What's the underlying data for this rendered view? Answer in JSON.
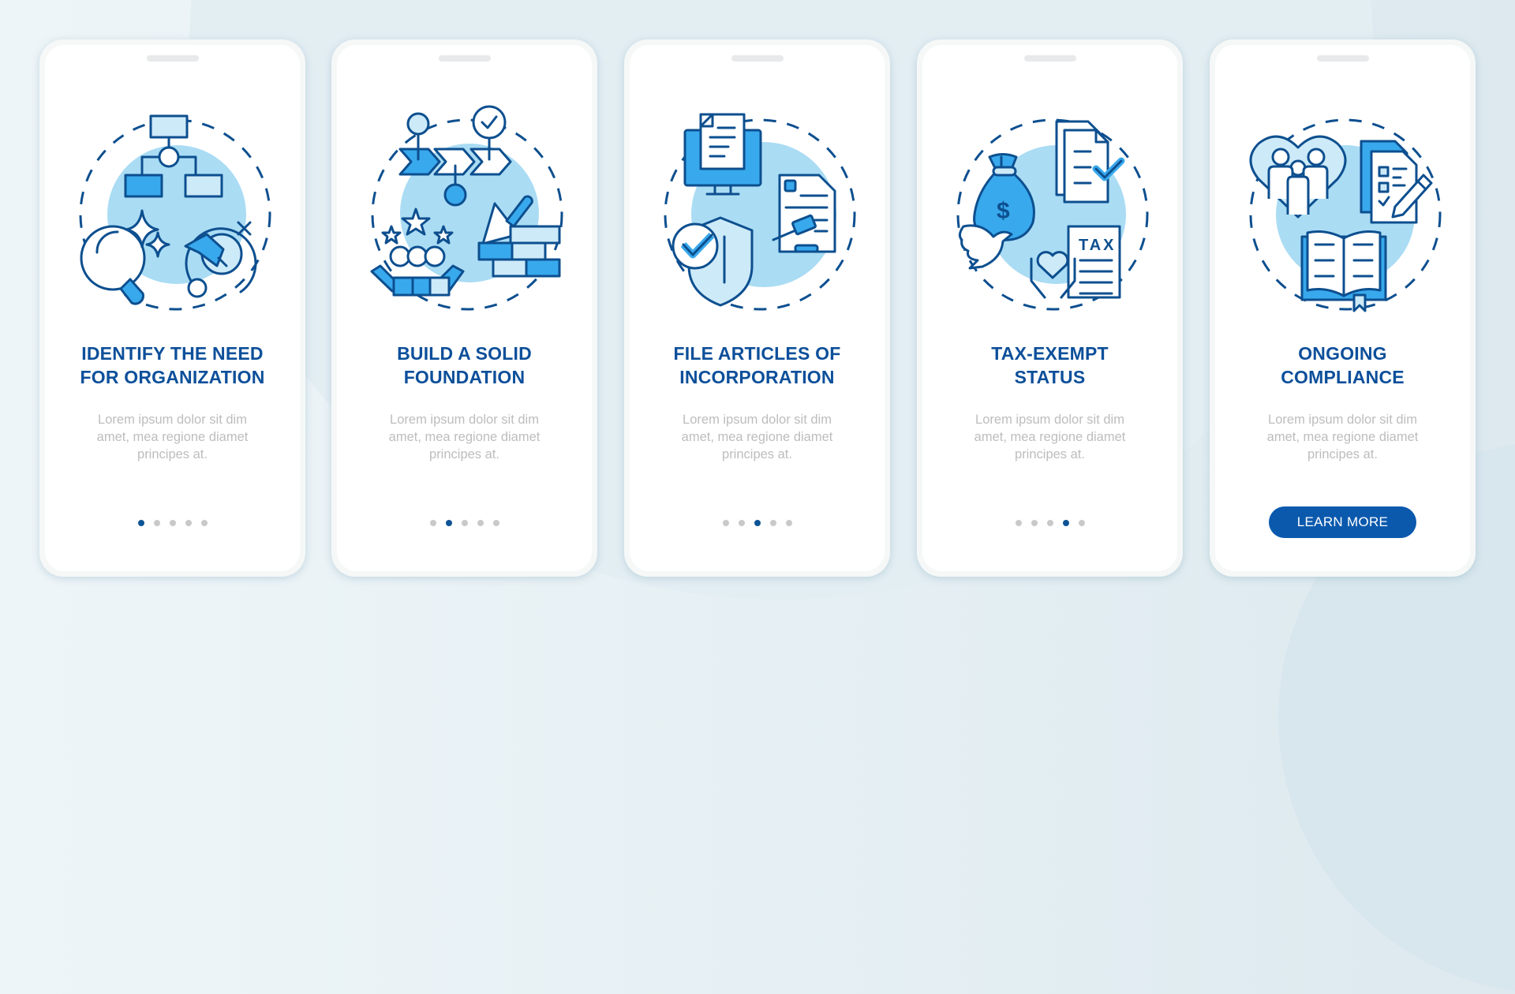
{
  "screens": [
    {
      "illustration": "organization-chart-icon",
      "title_lines": [
        "IDENTIFY THE NEED",
        "FOR ORGANIZATION"
      ],
      "description_lines": [
        "Lorem ipsum dolor sit dim",
        "amet, mea regione diamet",
        "principes at."
      ],
      "active_dot": 1
    },
    {
      "illustration": "foundation-bricks-icon",
      "title_lines": [
        "BUILD A SOLID",
        "FOUNDATION"
      ],
      "description_lines": [
        "Lorem ipsum dolor sit dim",
        "amet, mea regione diamet",
        "principes at."
      ],
      "active_dot": 2
    },
    {
      "illustration": "legal-documents-icon",
      "title_lines": [
        "FILE ARTICLES OF",
        "INCORPORATION"
      ],
      "description_lines": [
        "Lorem ipsum dolor sit dim",
        "amet, mea regione diamet",
        "principes at."
      ],
      "active_dot": 3
    },
    {
      "illustration": "tax-exempt-icon",
      "title_lines": [
        "TAX-EXEMPT",
        "STATUS"
      ],
      "description_lines": [
        "Lorem ipsum dolor sit dim",
        "amet, mea regione diamet",
        "principes at."
      ],
      "active_dot": 4
    },
    {
      "illustration": "compliance-book-icon",
      "title_lines": [
        "ONGOING",
        "COMPLIANCE"
      ],
      "description_lines": [
        "Lorem ipsum dolor sit dim",
        "amet, mea regione diamet",
        "principes at."
      ],
      "button_label": "LEARN MORE"
    }
  ],
  "pagination_total": 5,
  "illustration_text": {
    "tax_label": "TAX",
    "dollar_sign": "$"
  },
  "colors": {
    "title": "#0d4f9a",
    "description": "#bdbdbd",
    "accent": "#0b59ad",
    "dot_active": "#0d5496",
    "dot_inactive": "#c9c9c9",
    "illustration_fill": "#aadcf4",
    "illustration_stroke": "#0d4f8f"
  }
}
